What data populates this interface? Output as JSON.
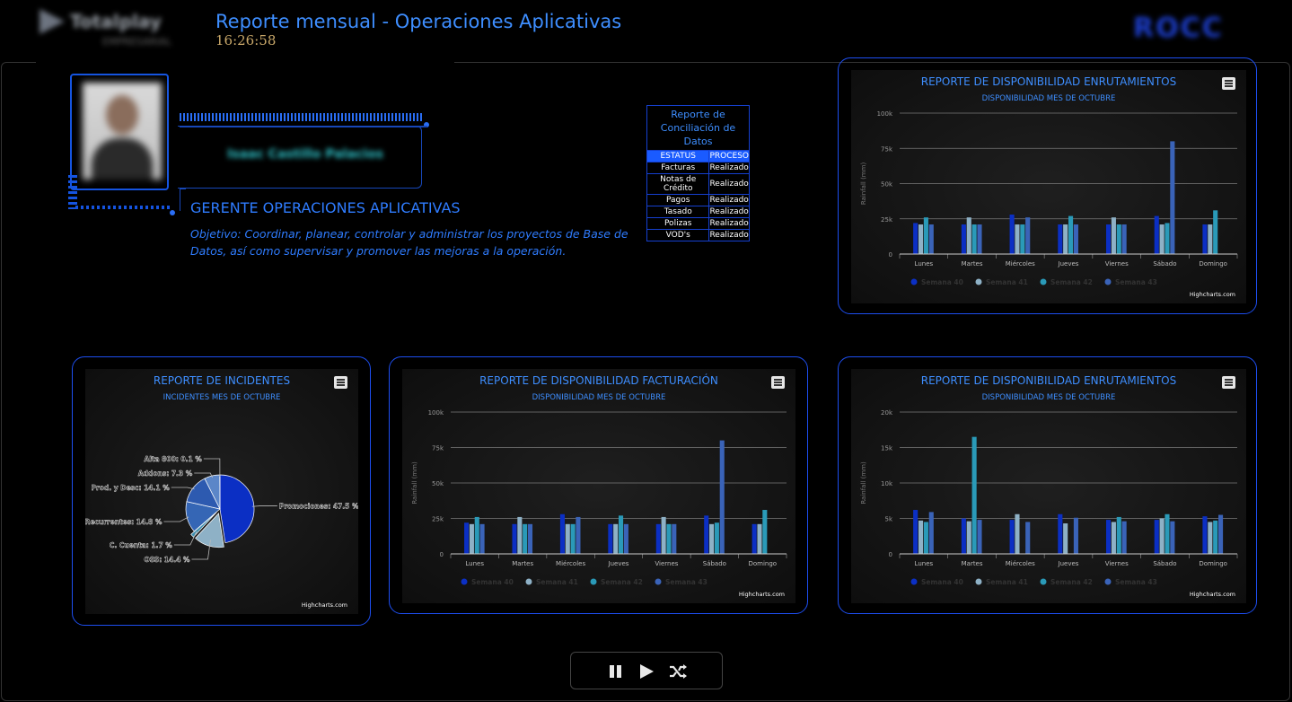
{
  "header": {
    "logo_text": "Totalplay",
    "logo_sub": "EMPRESARIAL",
    "title": "Reporte mensual - Operaciones Aplicativas",
    "clock": "16:26:58",
    "right_logo_text": "ROCC"
  },
  "profile": {
    "name": "Isaac Castillo Palacios",
    "role": "GERENTE OPERACIONES APLICATIVAS",
    "objective": "Objetivo: Coordinar, planear, controlar y administrar los proyectos de Base de Datos, así como supervisar y promover las mejoras a la operación."
  },
  "conciliacion": {
    "caption": "Reporte de Conciliación de Datos",
    "headers": [
      "ESTATUS",
      "PROCESO"
    ],
    "rows": [
      [
        "Facturas",
        "Realizado"
      ],
      [
        "Notas de Crédito",
        "Realizado"
      ],
      [
        "Pagos",
        "Realizado"
      ],
      [
        "Tasado",
        "Realizado"
      ],
      [
        "Polizas",
        "Realizado"
      ],
      [
        "VOD's",
        "Realizado"
      ]
    ]
  },
  "colors": {
    "accent": "#3e8eff",
    "border": "#1d4ef0",
    "series": [
      "#0b2fc4",
      "#8eb1c6",
      "#2a9ab8",
      "#3a63b8"
    ],
    "pie": [
      "#0b2fc4",
      "#8eb1c6",
      "#3f8fb0",
      "#3566b5",
      "#2d5ab0",
      "#5b86c8",
      "#9fc3d8",
      "#6fa8c8"
    ]
  },
  "icons": {
    "menu": "hamburger-icon",
    "pause": "pause-icon",
    "play": "play-icon",
    "shuffle": "shuffle-icon"
  },
  "credits": "Highcharts.com",
  "chart_data": [
    {
      "id": "enrut-top",
      "type": "bar",
      "title": "REPORTE DE DISPONIBILIDAD ENRUTAMIENTOS",
      "subtitle": "DISPONIBILIDAD MES DE OCTUBRE",
      "ylabel": "Rainfall (mm)",
      "ylim": [
        0,
        100000
      ],
      "yticks": [
        0,
        25000,
        50000,
        75000,
        100000
      ],
      "ytick_labels": [
        "0",
        "25k",
        "50k",
        "75k",
        "100k"
      ],
      "categories": [
        "Lunes",
        "Martes",
        "Miércoles",
        "Jueves",
        "Viernes",
        "Sábado",
        "Domingo"
      ],
      "series": [
        {
          "name": "Semana 40",
          "values": [
            22000,
            21000,
            28000,
            21000,
            21000,
            27000,
            21000
          ]
        },
        {
          "name": "Semana 41",
          "values": [
            21000,
            26000,
            21000,
            21000,
            26000,
            21000,
            21000
          ]
        },
        {
          "name": "Semana 42",
          "values": [
            26000,
            21000,
            21000,
            27000,
            21000,
            22000,
            31000
          ]
        },
        {
          "name": "Semana 43",
          "values": [
            21000,
            21000,
            26000,
            21000,
            21000,
            80000,
            null
          ]
        }
      ],
      "legend": "bottom",
      "grid": true
    },
    {
      "id": "incidentes",
      "type": "pie",
      "title": "REPORTE DE INCIDENTES",
      "subtitle": "INCIDENTES MES DE OCTUBRE",
      "slices": [
        {
          "label": "Promociones: 47.5 %",
          "value": 47.5
        },
        {
          "label": "OSS: 14.4 %",
          "value": 14.4
        },
        {
          "label": "C. Cuenta: 1.7 %",
          "value": 1.7
        },
        {
          "label": "Recurrentes: 14.8 %",
          "value": 14.8
        },
        {
          "label": "Prod. y Desc: 14.1 %",
          "value": 14.1
        },
        {
          "label": "Addons: 7.3 %",
          "value": 7.3
        },
        {
          "label": "Alta 800: 0.1 %",
          "value": 0.1
        }
      ]
    },
    {
      "id": "facturacion",
      "type": "bar",
      "title": "REPORTE DE DISPONIBILIDAD FACTURACIÓN",
      "subtitle": "DISPONIBILIDAD MES DE OCTUBRE",
      "ylabel": "Rainfall (mm)",
      "ylim": [
        0,
        100000
      ],
      "yticks": [
        0,
        25000,
        50000,
        75000,
        100000
      ],
      "ytick_labels": [
        "0",
        "25k",
        "50k",
        "75k",
        "100k"
      ],
      "categories": [
        "Lunes",
        "Martes",
        "Miércoles",
        "Jueves",
        "Viernes",
        "Sábado",
        "Domingo"
      ],
      "series": [
        {
          "name": "Semana 40",
          "values": [
            22000,
            21000,
            28000,
            21000,
            21000,
            27000,
            21000
          ]
        },
        {
          "name": "Semana 41",
          "values": [
            21000,
            26000,
            21000,
            21000,
            26000,
            21000,
            21000
          ]
        },
        {
          "name": "Semana 42",
          "values": [
            26000,
            21000,
            21000,
            27000,
            21000,
            22000,
            31000
          ]
        },
        {
          "name": "Semana 43",
          "values": [
            21000,
            21000,
            26000,
            21000,
            21000,
            80000,
            null
          ]
        }
      ],
      "legend": "bottom",
      "grid": true
    },
    {
      "id": "enrut-bottom",
      "type": "bar",
      "title": "REPORTE DE DISPONIBILIDAD ENRUTAMIENTOS",
      "subtitle": "DISPONIBILIDAD MES DE OCTUBRE",
      "ylabel": "Rainfall (mm)",
      "ylim": [
        0,
        20000
      ],
      "yticks": [
        0,
        5000,
        10000,
        15000,
        20000
      ],
      "ytick_labels": [
        "0",
        "5k",
        "10k",
        "15k",
        "20k"
      ],
      "categories": [
        "Lunes",
        "Martes",
        "Miércoles",
        "Jueves",
        "Viernes",
        "Sábado",
        "Domingo"
      ],
      "series": [
        {
          "name": "Semana 40",
          "values": [
            6200,
            5000,
            4800,
            5600,
            4800,
            4800,
            5300
          ]
        },
        {
          "name": "Semana 41",
          "values": [
            4700,
            4600,
            5600,
            4300,
            4500,
            5000,
            4500
          ]
        },
        {
          "name": "Semana 42",
          "values": [
            4500,
            16500,
            null,
            null,
            5200,
            5600,
            4700
          ]
        },
        {
          "name": "Semana 43",
          "values": [
            5900,
            4800,
            4500,
            5100,
            4600,
            4600,
            5500
          ]
        }
      ],
      "legend": "bottom",
      "grid": true
    }
  ]
}
